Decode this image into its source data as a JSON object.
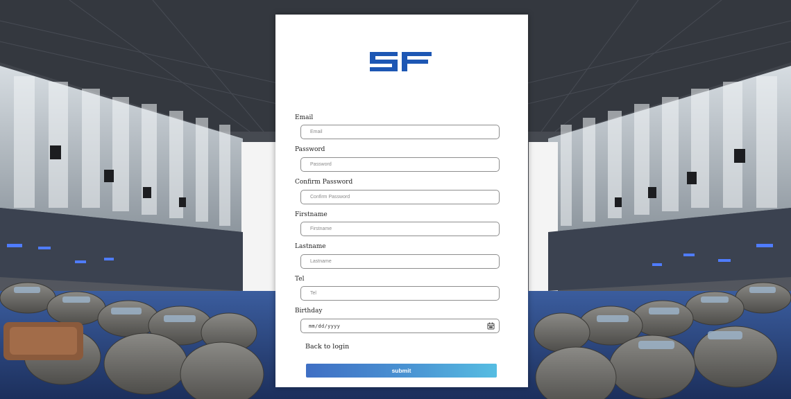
{
  "logo": {
    "text": "SF",
    "color": "#1d57b4"
  },
  "form": {
    "fields": [
      {
        "label": "Email",
        "placeholder": "Email",
        "value": ""
      },
      {
        "label": "Password",
        "placeholder": "Password",
        "value": ""
      },
      {
        "label": "Confirm Password",
        "placeholder": "Confirm Password",
        "value": ""
      },
      {
        "label": "Firstname",
        "placeholder": "Firstname",
        "value": ""
      },
      {
        "label": "Lastname",
        "placeholder": "Lastname",
        "value": ""
      },
      {
        "label": "Tel",
        "placeholder": "Tel",
        "value": ""
      }
    ],
    "birthday": {
      "label": "Birthday",
      "placeholder": "mm/dd/yyyy",
      "icon": "calendar-icon"
    },
    "back_link": "Back to login",
    "submit_label": "submit"
  },
  "colors": {
    "accent_start": "#3f6fc4",
    "accent_end": "#56bde2",
    "card_bg": "#ffffff"
  }
}
